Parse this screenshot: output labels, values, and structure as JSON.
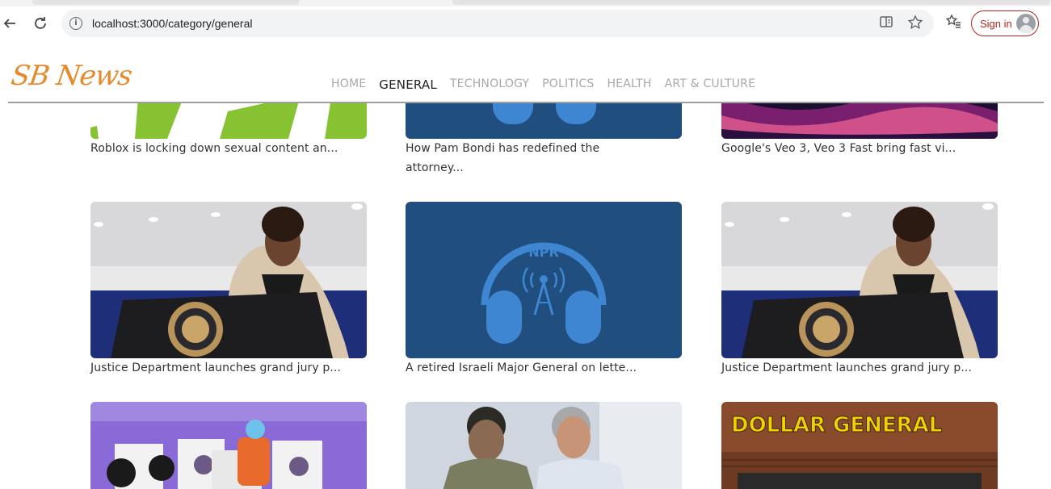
{
  "browser": {
    "url": "localhost:3000/category/general",
    "sign_in_label": "Sign in",
    "icons": [
      "back-icon",
      "reload-icon",
      "info-icon",
      "split-view-icon",
      "star-icon",
      "favorites-list-icon",
      "profile-icon"
    ]
  },
  "site": {
    "logo": "SB News",
    "menu": [
      {
        "label": "HOME",
        "active": false
      },
      {
        "label": "GENERAL",
        "active": true
      },
      {
        "label": "TECHNOLOGY",
        "active": false
      },
      {
        "label": "POLITICS",
        "active": false
      },
      {
        "label": "HEALTH",
        "active": false
      },
      {
        "label": "ART & CULTURE",
        "active": false
      }
    ],
    "accent_color": "#e68a2e"
  },
  "articles": [
    {
      "caption": "Roblox is locking down sexual content an..."
    },
    {
      "caption": "How Pam Bondi has redefined the attorney..."
    },
    {
      "caption": "Google's Veo 3, Veo 3 Fast bring fast vi..."
    },
    {
      "caption": "Justice Department launches grand jury p..."
    },
    {
      "caption": "A retired Israeli Major General on lette...",
      "image_text": "NPR"
    },
    {
      "caption": "Justice Department launches grand jury p..."
    },
    {
      "caption": ""
    },
    {
      "caption": ""
    },
    {
      "caption": "",
      "image_text": "DOLLAR GENERAL"
    }
  ]
}
